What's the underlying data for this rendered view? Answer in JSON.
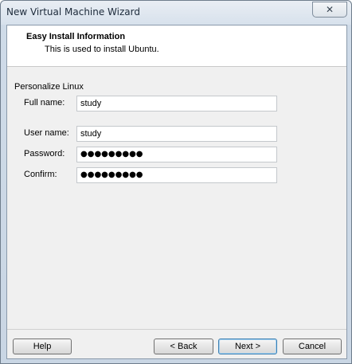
{
  "window": {
    "title": "New Virtual Machine Wizard",
    "close_glyph": "✕"
  },
  "header": {
    "title": "Easy Install Information",
    "subtitle": "This is used to install Ubuntu."
  },
  "form": {
    "group_label": "Personalize Linux",
    "fields": [
      {
        "label": "Full name:",
        "value": "study"
      },
      {
        "label": "User name:",
        "value": "study"
      },
      {
        "label": "Password:",
        "value": "●●●●●●●●●"
      },
      {
        "label": "Confirm:",
        "value": "●●●●●●●●●"
      }
    ]
  },
  "buttons": {
    "help": "Help",
    "back": "< Back",
    "next": "Next >",
    "cancel": "Cancel"
  }
}
